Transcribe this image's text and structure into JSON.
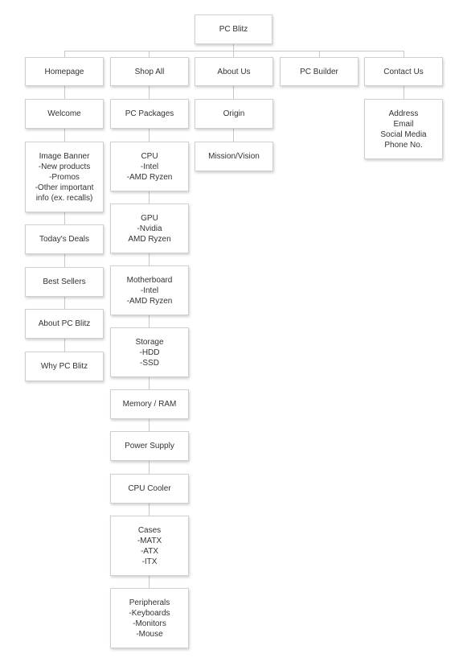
{
  "root": "PC Blitz",
  "columns": {
    "homepage": {
      "header": "Homepage",
      "items": [
        "Welcome",
        "Image Banner\n-New products\n-Promos\n-Other important\ninfo (ex. recalls)",
        "Today's Deals",
        "Best Sellers",
        "About PC Blitz",
        "Why PC Blitz"
      ]
    },
    "shop": {
      "header": "Shop All",
      "items": [
        "PC Packages",
        "CPU\n-Intel\n-AMD Ryzen",
        "GPU\n-Nvidia\nAMD Ryzen",
        "Motherboard\n-Intel\n-AMD Ryzen",
        "Storage\n-HDD\n-SSD",
        "Memory / RAM",
        "Power Supply",
        "CPU Cooler",
        "Cases\n-MATX\n-ATX\n-ITX",
        "Peripherals\n-Keyboards\n-Monitors\n-Mouse"
      ]
    },
    "about": {
      "header": "About Us",
      "items": [
        "Origin",
        "Mission/Vision"
      ]
    },
    "builder": {
      "header": "PC Builder",
      "items": []
    },
    "contact": {
      "header": "Contact Us",
      "items": [
        "Address\nEmail\nSocial Media\nPhone No."
      ]
    }
  }
}
